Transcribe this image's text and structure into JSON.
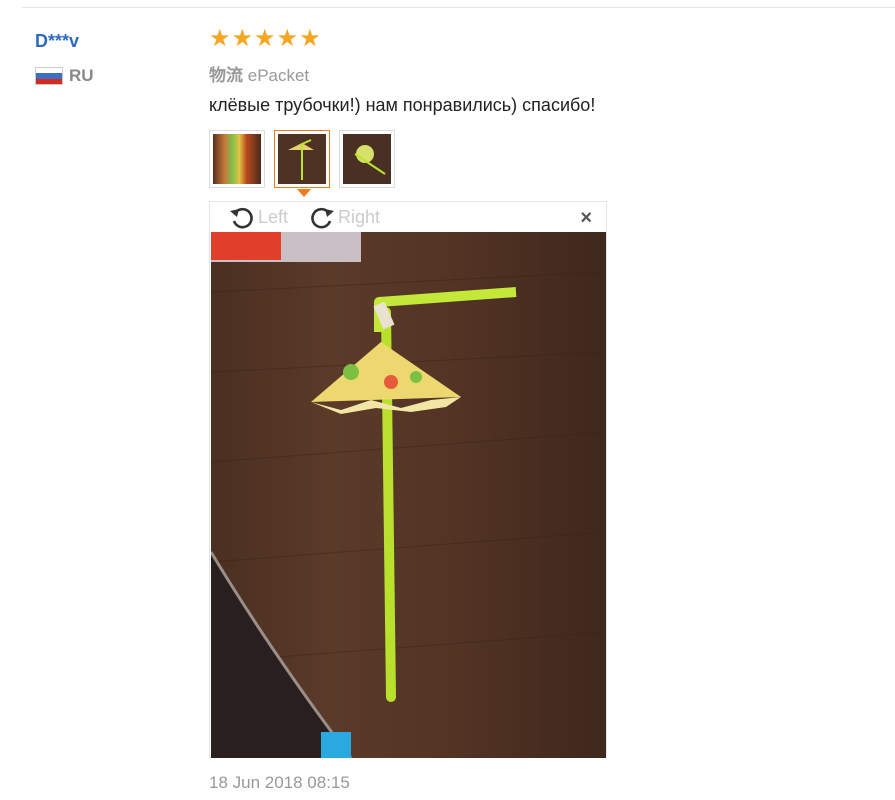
{
  "review": {
    "user": "D***v",
    "country": "RU",
    "rating": 5,
    "stars": [
      "★",
      "★",
      "★",
      "★",
      "★"
    ],
    "shipping_label": "物流",
    "shipping_method": "ePacket",
    "text": "клёвые трубочки!) нам понравились) спасибо!",
    "date": "18 Jun 2018 08:15"
  },
  "viewer": {
    "rotate_left": "Left",
    "rotate_right": "Right",
    "close": "×"
  },
  "colors": {
    "username": "#2d6bc1",
    "star": "#f5a623",
    "active_thumb": "#f27a1a"
  }
}
